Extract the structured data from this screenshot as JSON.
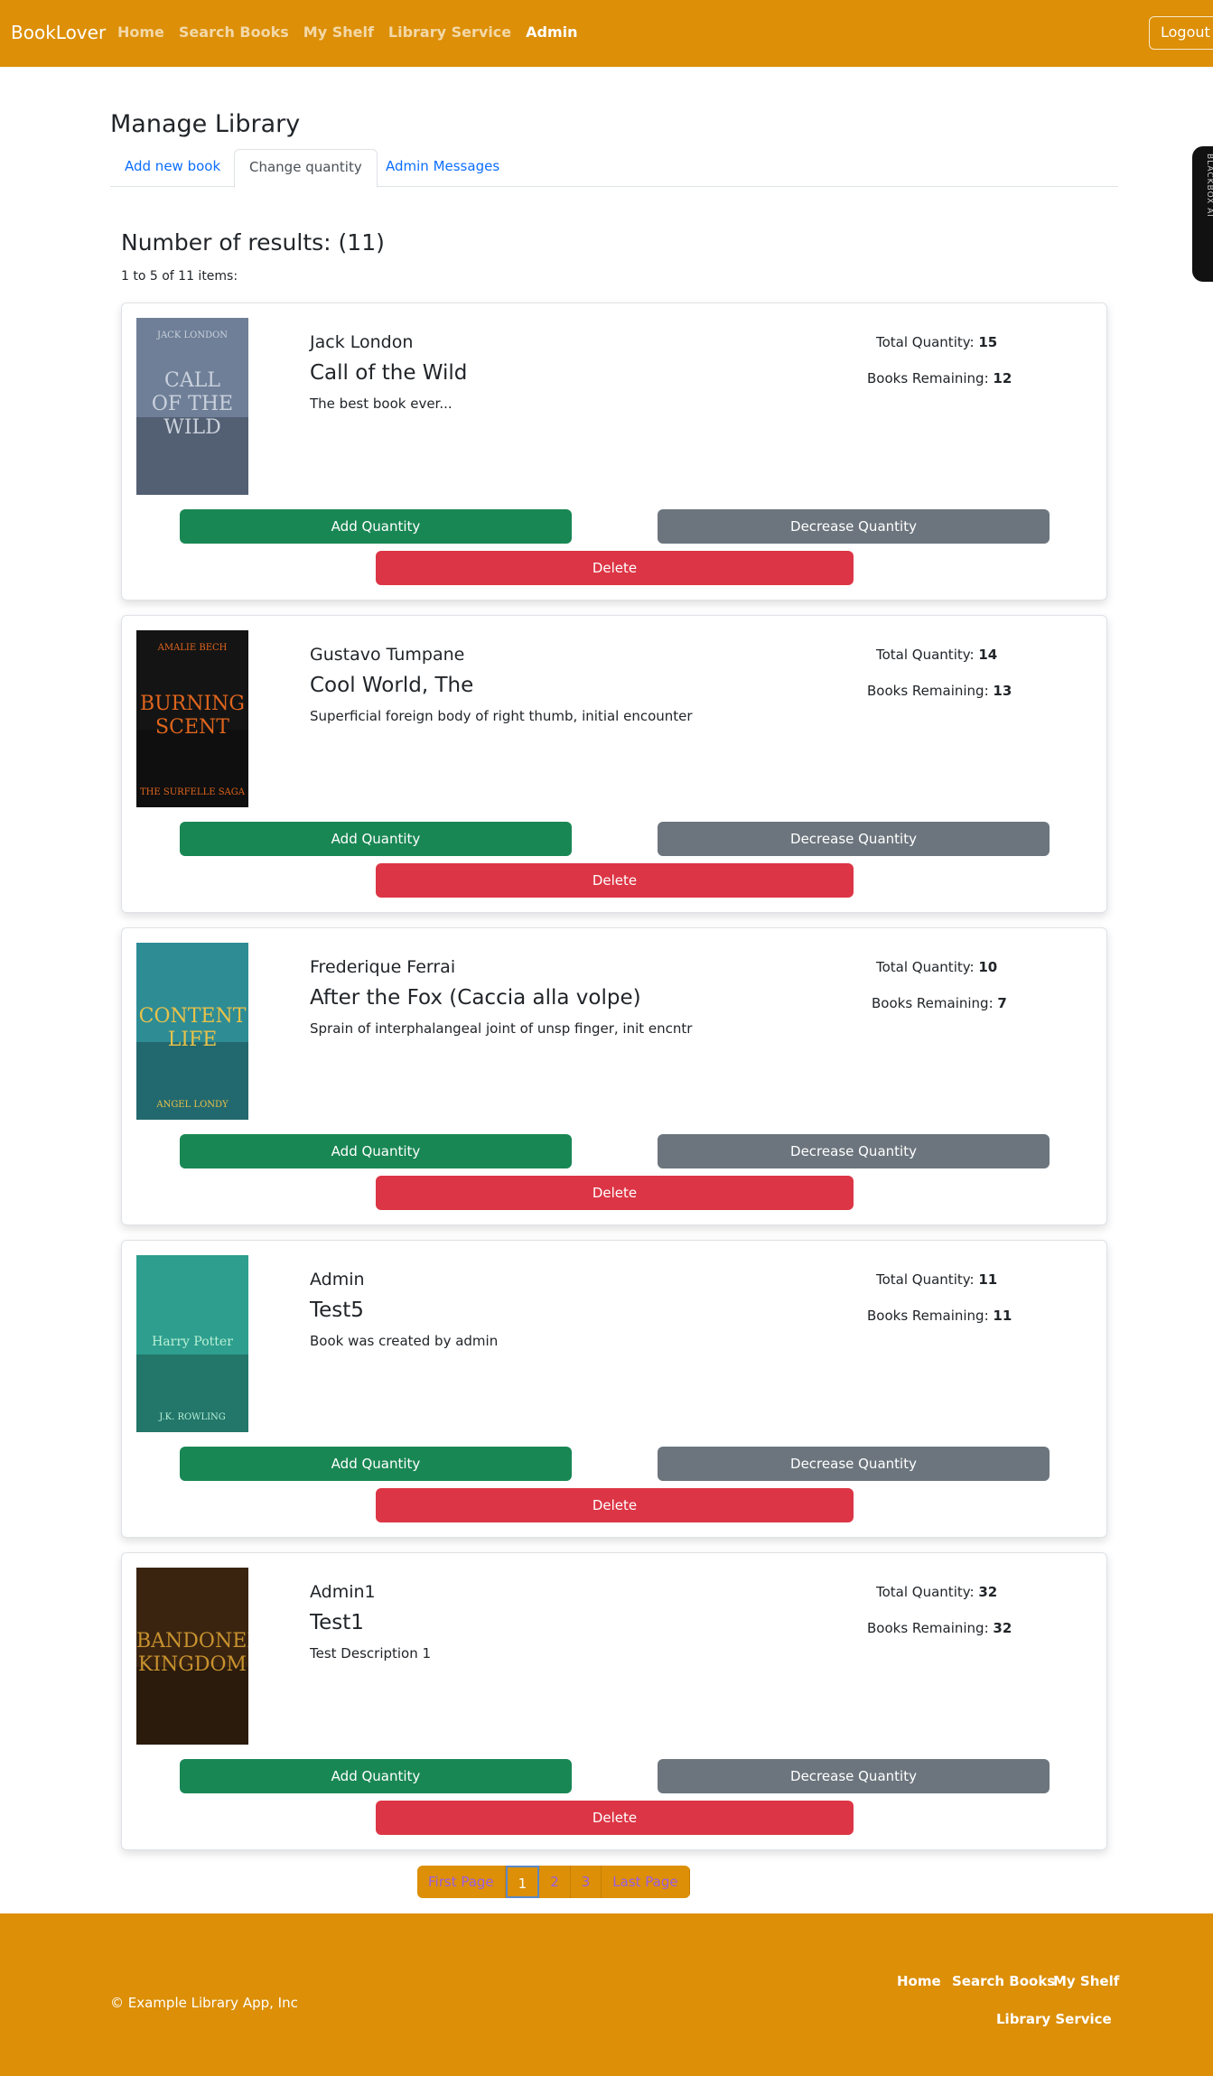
{
  "navbar": {
    "brand": "BookLover",
    "links": [
      "Home",
      "Search Books",
      "My Shelf",
      "Library Service",
      "Admin"
    ],
    "logout_label": "Logout"
  },
  "side_tab": {
    "label": "BLACKBOX AI"
  },
  "page": {
    "title": "Manage Library",
    "tabs": [
      "Add new book",
      "Change quantity",
      "Admin Messages"
    ],
    "results_title": "Number of results: (11)",
    "results_range": "1 to 5 of 11 items:"
  },
  "labels": {
    "total_quantity": "Total Quantity:",
    "books_remaining": "Books Remaining:",
    "add_button": "Add Quantity",
    "decrease_button": "Decrease Quantity",
    "delete_button": "Delete"
  },
  "books": [
    {
      "author": "Jack London",
      "title": "Call of the Wild",
      "description": "The best book ever...",
      "total_quantity": "15",
      "books_remaining": "12",
      "cover": {
        "top_text": "JACK LONDON",
        "main_text": [
          "CALL",
          "OF THE",
          "WILD"
        ],
        "bottom_text": "",
        "bg": "#6f7f98",
        "accent": "#c9d1dc"
      }
    },
    {
      "author": "Gustavo Tumpane",
      "title": "Cool World, The",
      "description": "Superficial foreign body of right thumb, initial encounter",
      "total_quantity": "14",
      "books_remaining": "13",
      "cover": {
        "top_text": "AMALIE BECH",
        "main_text": [
          "BURNING",
          "SCENT"
        ],
        "bottom_text": "THE SURFELLE SAGA",
        "bg": "#141414",
        "accent": "#e0651d"
      }
    },
    {
      "author": "Frederique Ferrai",
      "title": "After the Fox (Caccia alla volpe)",
      "description": "Sprain of interphalangeal joint of unsp finger, init encntr",
      "total_quantity": "10",
      "books_remaining": "7",
      "cover": {
        "top_text": "",
        "main_text": [
          "CONTENT",
          "LIFE"
        ],
        "bottom_text": "ANGEL LONDY",
        "bg": "#2e8c95",
        "accent": "#e8c24a"
      }
    },
    {
      "author": "Admin",
      "title": "Test5",
      "description": "Book was created by admin",
      "total_quantity": "11",
      "books_remaining": "11",
      "cover": {
        "top_text": "",
        "main_text": [
          "Harry Potter"
        ],
        "bottom_text": "J.K. ROWLING",
        "bg": "#2e9e8e",
        "accent": "#b8f0d6"
      }
    },
    {
      "author": "Admin1",
      "title": "Test1",
      "description": "Test Description 1",
      "total_quantity": "32",
      "books_remaining": "32",
      "cover": {
        "top_text": "",
        "main_text": [
          "ABANDONED",
          "KINGDOM"
        ],
        "bottom_text": "",
        "bg": "#3a2410",
        "accent": "#c8922e"
      }
    }
  ],
  "pagination": [
    "First Page",
    "1",
    "2",
    "3",
    "Last Page"
  ],
  "footer": {
    "copyright": "© Example Library App, Inc",
    "links": [
      "Home",
      "Search Books",
      "My Shelf",
      "Library Service"
    ]
  }
}
